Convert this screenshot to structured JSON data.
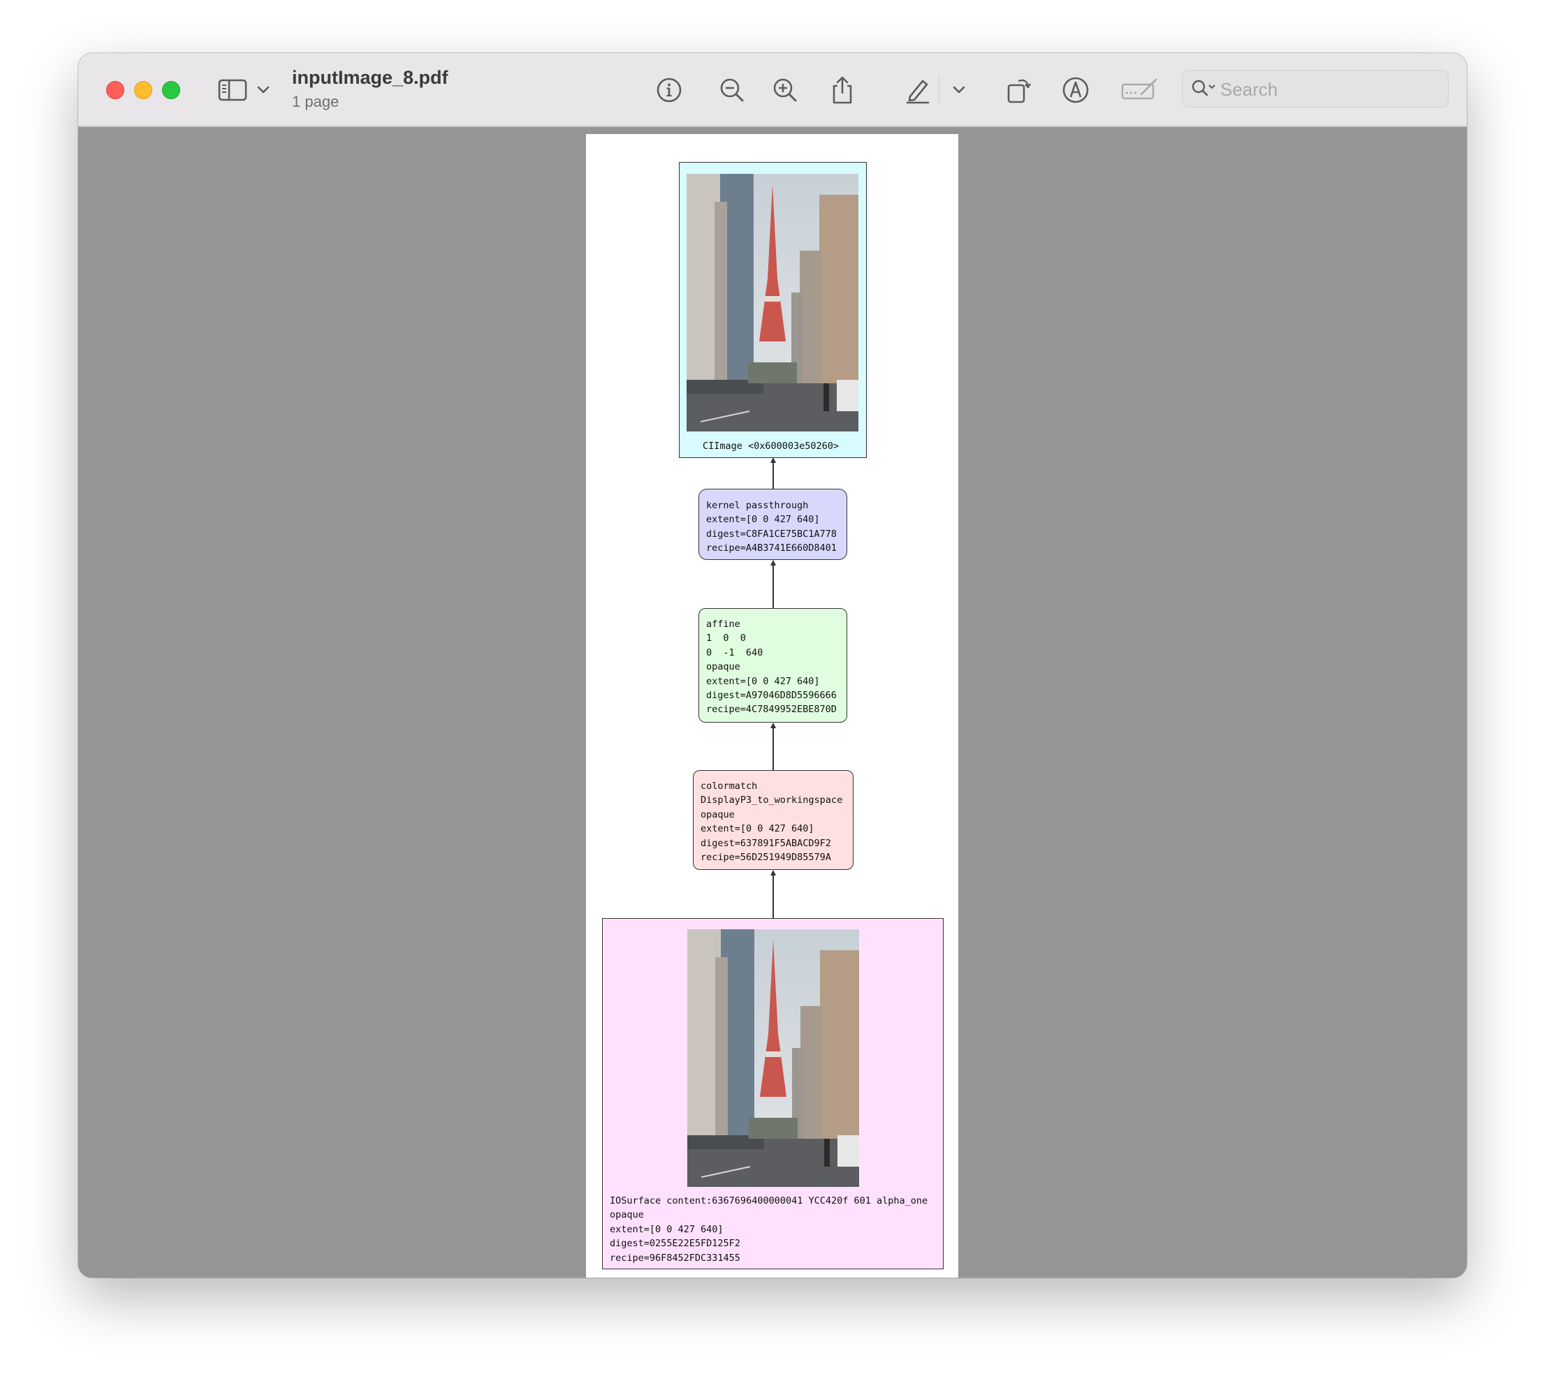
{
  "window": {
    "title": "inputImage_8.pdf",
    "subtitle": "1 page"
  },
  "toolbar": {
    "search_placeholder": "Search",
    "icons": [
      "sidebar-icon",
      "chevron-down-icon",
      "info-icon",
      "zoom-out-icon",
      "zoom-in-icon",
      "share-icon",
      "highlight-pen-icon",
      "chevron-down-icon",
      "rotate-icon",
      "markup-icon",
      "signature-icon",
      "search-icon"
    ]
  },
  "graph": {
    "top_node": {
      "caption": "CIImage <0x600003e50260>"
    },
    "kernel_node": {
      "lines": [
        "kernel passthrough",
        "extent=[0 0 427 640]",
        "digest=C8FA1CE75BC1A778",
        "recipe=A4B3741E660D8401"
      ]
    },
    "affine_node": {
      "lines": [
        "affine",
        "1  0  0",
        "0  -1  640",
        "opaque",
        "extent=[0 0 427 640]",
        "digest=A97046D8D5596666",
        "recipe=4C7849952EBE870D"
      ]
    },
    "colormatch_node": {
      "lines": [
        "colormatch",
        "DisplayP3_to_workingspace",
        "opaque",
        "extent=[0 0 427 640]",
        "digest=637891F5ABACD9F2",
        "recipe=56D251949D85579A"
      ]
    },
    "surface_node": {
      "lines": [
        "IOSurface content:6367696400000041 YCC420f 601 alpha_one",
        "opaque",
        "extent=[0 0 427 640]",
        "digest=0255E22E5FD125F2",
        "recipe=96F8452FDC331455"
      ]
    }
  },
  "colors": {
    "cyan_node": "#d7fbff",
    "blue_node": "#d8d8fd",
    "green_node": "#e1fde0",
    "red_node": "#ffe0e0",
    "pink_node": "#ffe1fe",
    "window_background": "#959595"
  }
}
